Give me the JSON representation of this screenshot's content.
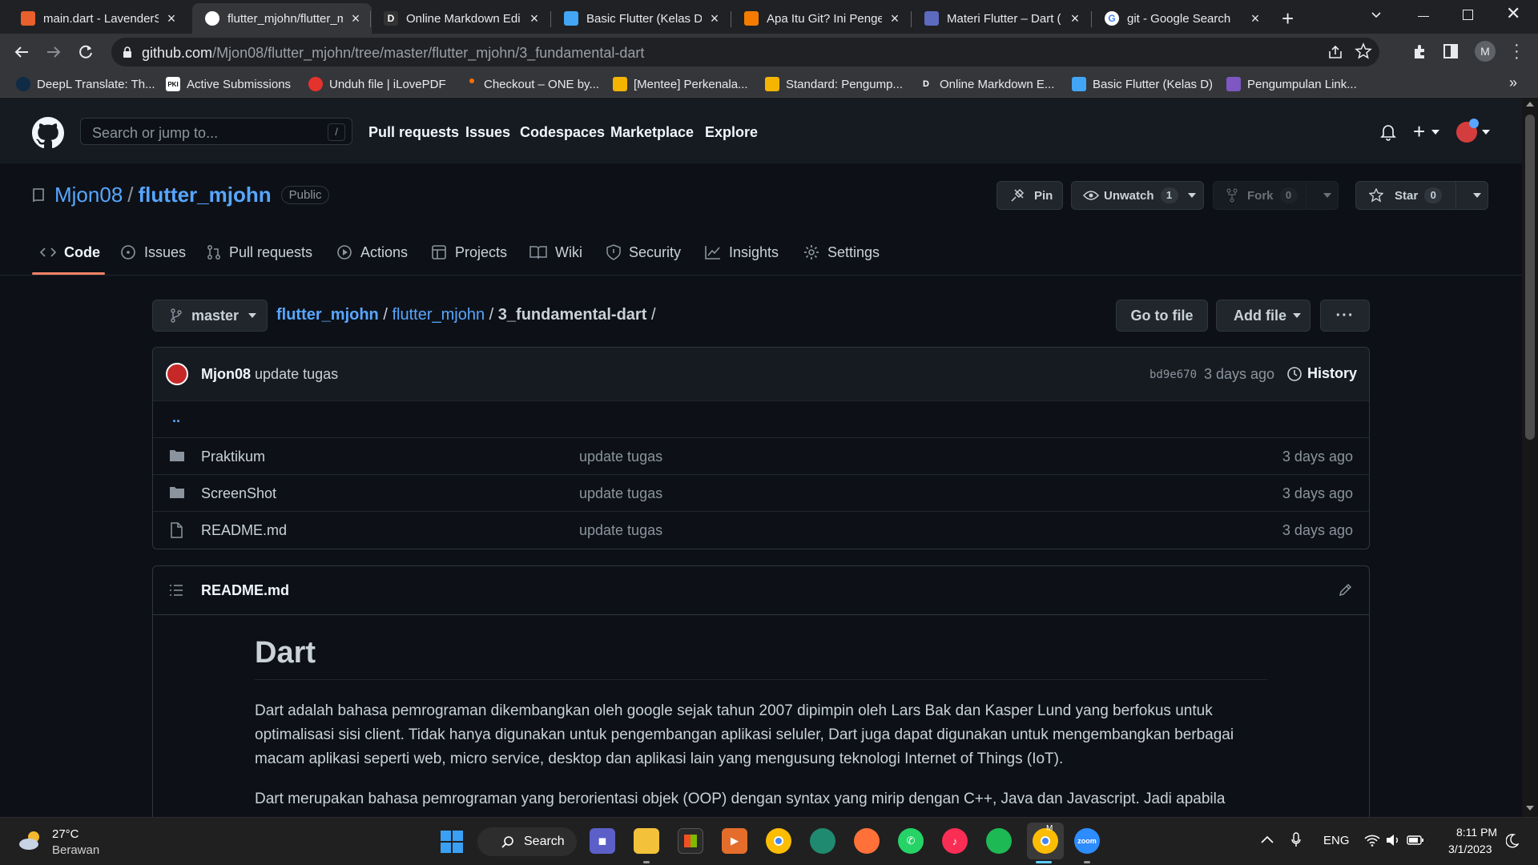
{
  "browser": {
    "tabs": [
      {
        "title": "main.dart - LavenderS",
        "favicon": "sourcetree-icon",
        "color": "#e8602c"
      },
      {
        "title": "flutter_mjohn/flutter_m",
        "favicon": "github-icon",
        "color": "#ffffff"
      },
      {
        "title": "Online Markdown Edi",
        "favicon": "D",
        "color": "#ffffff"
      },
      {
        "title": "Basic Flutter (Kelas D)",
        "favicon": "flutter-icon",
        "color": "#42a5f5"
      },
      {
        "title": "Apa Itu Git? Ini Penge",
        "favicon": "dw-icon",
        "color": "#f57c00"
      },
      {
        "title": "Materi Flutter – Dart (",
        "favicon": "dots-icon",
        "color": "#5c6bc0"
      },
      {
        "title": "git - Google Search",
        "favicon": "google-icon",
        "color": "#ffffff"
      }
    ],
    "url_host": "github.com",
    "url_path": "/Mjon08/flutter_mjohn/tree/master/flutter_mjohn/3_fundamental-dart",
    "profile_initial": "M",
    "bookmarks": [
      {
        "label": "DeepL Translate: Th...",
        "icon": "deepl-icon",
        "color": "#0f2b46"
      },
      {
        "label": "Active Submissions",
        "icon": "pki-icon",
        "color": "#ffffff",
        "glyph": "PKI"
      },
      {
        "label": "Unduh file | iLovePDF",
        "icon": "heart-icon",
        "color": "#e5322d"
      },
      {
        "label": "Checkout – ONE by...",
        "icon": "dot-icon",
        "color": "#ff6d00"
      },
      {
        "label": "[Mentee] Perkenala...",
        "icon": "slides-icon",
        "color": "#f4b400"
      },
      {
        "label": "Standard: Pengump...",
        "icon": "slides-icon",
        "color": "#f4b400"
      },
      {
        "label": "Online Markdown E...",
        "icon": "D",
        "color": "#ffffff"
      },
      {
        "label": "Basic Flutter (Kelas D)",
        "icon": "flutter-icon",
        "color": "#42a5f5"
      },
      {
        "label": "Pengumpulan Link...",
        "icon": "forms-icon",
        "color": "#7e57c2"
      }
    ],
    "bookmarks_more": "»"
  },
  "github": {
    "search_placeholder": "Search or jump to...",
    "search_key": "/",
    "nav": [
      "Pull requests",
      "Issues",
      "Codespaces",
      "Marketplace",
      "Explore"
    ]
  },
  "repo": {
    "owner": "Mjon08",
    "sep": "/",
    "name": "flutter_mjohn",
    "visibility": "Public",
    "pin": "Pin",
    "unwatch": "Unwatch",
    "unwatch_count": "1",
    "fork": "Fork",
    "fork_count": "0",
    "star": "Star",
    "star_count": "0",
    "tabs": [
      "Code",
      "Issues",
      "Pull requests",
      "Actions",
      "Projects",
      "Wiki",
      "Security",
      "Insights",
      "Settings"
    ]
  },
  "browser_path": {
    "branch": "master",
    "crumbs": [
      "flutter_mjohn",
      "flutter_mjohn"
    ],
    "current": "3_fundamental-dart",
    "go_to_file": "Go to file",
    "add_file": "Add file",
    "more": "···"
  },
  "commit": {
    "author": "Mjon08",
    "message": "update tugas",
    "sha": "bd9e670",
    "age": "3 days ago",
    "history": "History"
  },
  "files": {
    "parent": "..",
    "rows": [
      {
        "name": "Praktikum",
        "type": "folder",
        "message": "update tugas",
        "age": "3 days ago"
      },
      {
        "name": "ScreenShot",
        "type": "folder",
        "message": "update tugas",
        "age": "3 days ago"
      },
      {
        "name": "README.md",
        "type": "file",
        "message": "update tugas",
        "age": "3 days ago"
      }
    ]
  },
  "readme": {
    "filename": "README.md",
    "heading": "Dart",
    "p1": "Dart adalah bahasa pemrograman dikembangkan oleh google sejak tahun 2007 dipimpin oleh Lars Bak dan Kasper Lund yang berfokus untuk optimalisasi sisi client. Tidak hanya digunakan untuk pengembangan aplikasi seluler, Dart juga dapat digunakan untuk mengembangkan berbagai macam aplikasi seperti web, micro service, desktop dan aplikasi lain yang mengusung teknologi Internet of Things (IoT).",
    "p2": "Dart merupakan bahasa pemrograman yang berorientasi objek (OOP) dengan syntax yang mirip dengan C++, Java dan Javascript. Jadi apabila"
  },
  "taskbar": {
    "weather_temp": "27°C",
    "weather_desc": "Berawan",
    "search": "Search",
    "lang": "ENG",
    "time": "8:11 PM",
    "date": "3/1/2023",
    "chrome_badge": "M"
  }
}
